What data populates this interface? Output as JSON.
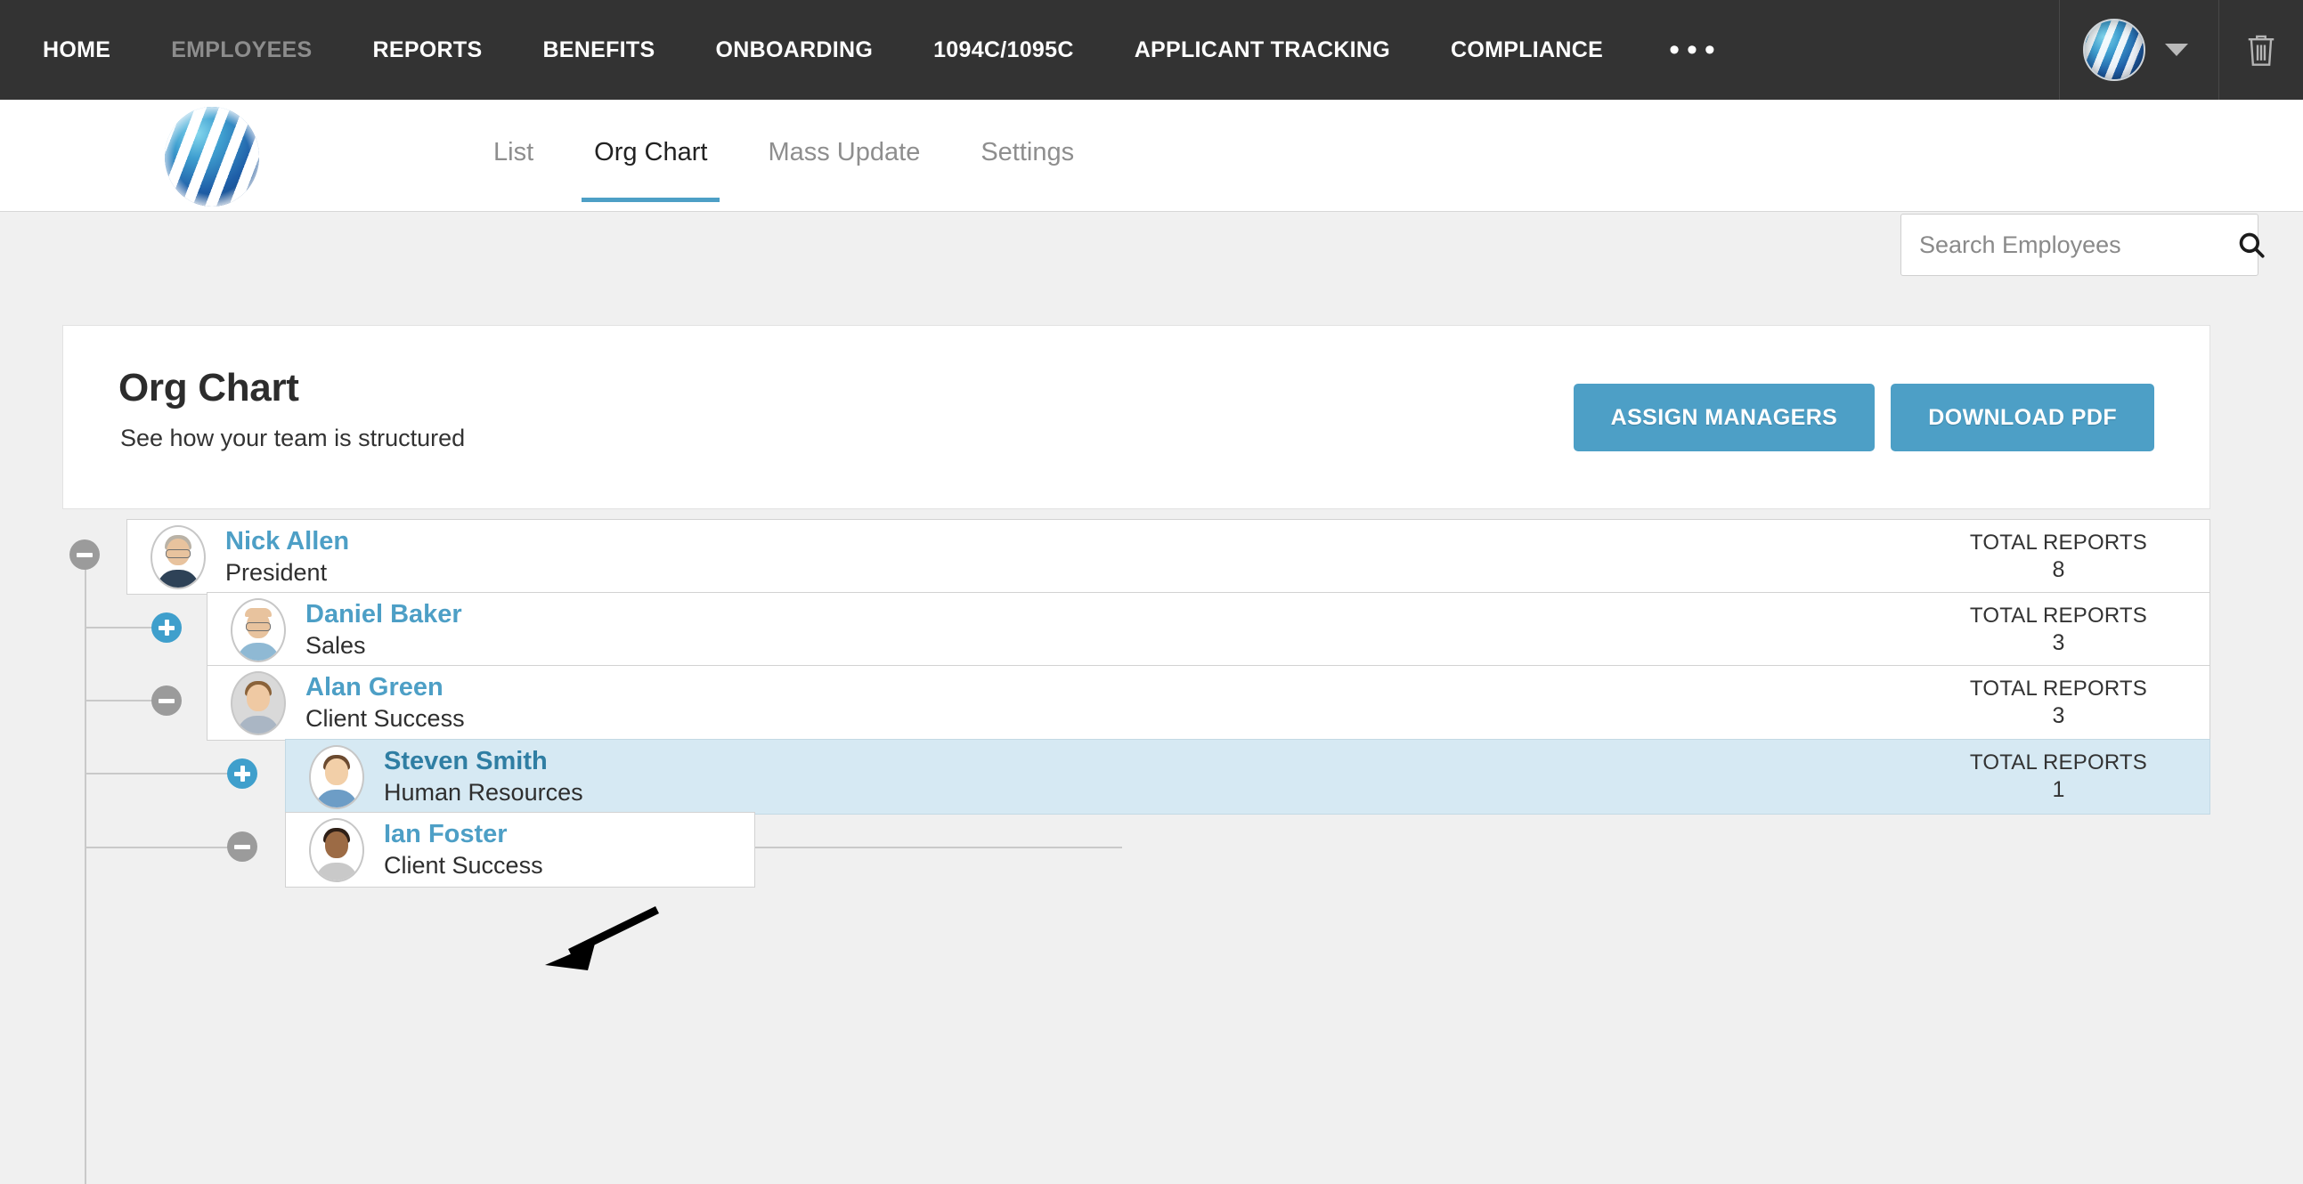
{
  "topnav": {
    "items": [
      {
        "label": "HOME",
        "state": "normal"
      },
      {
        "label": "EMPLOYEES",
        "state": "muted"
      },
      {
        "label": "REPORTS",
        "state": "normal"
      },
      {
        "label": "BENEFITS",
        "state": "normal"
      },
      {
        "label": "ONBOARDING",
        "state": "normal"
      },
      {
        "label": "1094C/1095C",
        "state": "normal"
      },
      {
        "label": "APPLICANT TRACKING",
        "state": "normal"
      },
      {
        "label": "COMPLIANCE",
        "state": "normal"
      }
    ],
    "more_label": "•••",
    "background": "#333333"
  },
  "subheader": {
    "tabs": [
      {
        "label": "List",
        "active": false
      },
      {
        "label": "Org Chart",
        "active": true
      },
      {
        "label": "Mass Update",
        "active": false
      },
      {
        "label": "Settings",
        "active": false
      }
    ],
    "search": {
      "placeholder": "Search Employees",
      "value": ""
    }
  },
  "card": {
    "title": "Org Chart",
    "subtitle": "See how your team is structured",
    "assign_managers_label": "ASSIGN MANAGERS",
    "download_pdf_label": "DOWNLOAD PDF",
    "accent": "#4d9fc6"
  },
  "org": {
    "reports_label": "TOTAL REPORTS",
    "highlight_color": "#d6e9f3",
    "nodes": [
      {
        "name": "Nick Allen",
        "title": "President",
        "reports": "8",
        "toggle": "minus",
        "level": 0,
        "highlighted": false
      },
      {
        "name": "Daniel Baker",
        "title": "Sales",
        "reports": "3",
        "toggle": "plus",
        "level": 1,
        "highlighted": false
      },
      {
        "name": "Alan Green",
        "title": "Client Success",
        "reports": "3",
        "toggle": "minus",
        "level": 1,
        "highlighted": false
      },
      {
        "name": "Steven Smith",
        "title": "Human Resources",
        "reports": "1",
        "toggle": "plus",
        "level": 2,
        "highlighted": true
      },
      {
        "name": "Ian Foster",
        "title": "Client Success",
        "reports": "",
        "toggle": "minus",
        "level": 2,
        "highlighted": false
      }
    ]
  }
}
